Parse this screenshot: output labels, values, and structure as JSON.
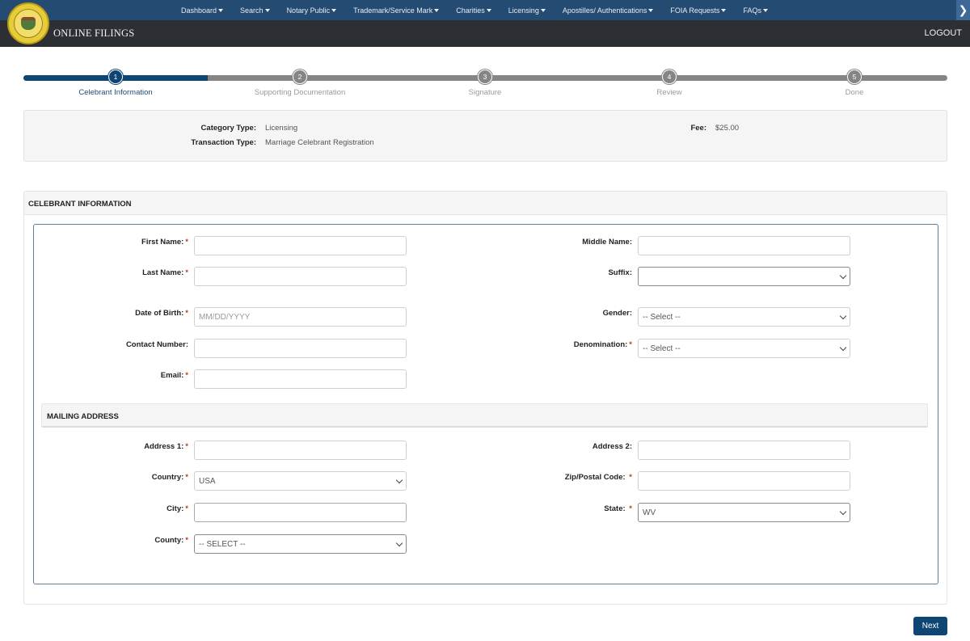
{
  "topnav": {
    "menu": [
      {
        "label": "Dashboard"
      },
      {
        "label": "Search"
      },
      {
        "label": "Notary Public"
      },
      {
        "label": "Trademark/Service Mark"
      },
      {
        "label": "Charities"
      },
      {
        "label": "Licensing"
      },
      {
        "label": "Apostilles/ Authentications"
      },
      {
        "label": "FOIA Requests"
      },
      {
        "label": "FAQs"
      }
    ],
    "expand_icon": "chevron-right"
  },
  "brand": {
    "title": "ONLINE FILINGS",
    "logout": "LOGOUT",
    "logo": "Secretary of State seal"
  },
  "stepper": {
    "current_step": 1,
    "steps": [
      {
        "number": "1",
        "label": "Celebrant Information"
      },
      {
        "number": "2",
        "label": "Supporting Documentation"
      },
      {
        "number": "3",
        "label": "Signature"
      },
      {
        "number": "4",
        "label": "Review"
      },
      {
        "number": "5",
        "label": "Done"
      }
    ]
  },
  "summary": {
    "category_type_label": "Category Type:",
    "category_type_value": "Licensing",
    "transaction_type_label": "Transaction Type:",
    "transaction_type_value": "Marriage Celebrant Registration",
    "fee_label": "Fee:",
    "fee_value": "$25.00"
  },
  "form": {
    "section_title": "CELEBRANT INFORMATION",
    "required_marker": "*",
    "fields": {
      "first_name": {
        "label": "First Name:",
        "value": "",
        "required": true
      },
      "middle_name": {
        "label": "Middle Name:",
        "value": "",
        "required": false
      },
      "last_name": {
        "label": "Last Name:",
        "value": "",
        "required": true
      },
      "suffix": {
        "label": "Suffix:",
        "value": "",
        "required": false
      },
      "date_of_birth": {
        "label": "Date of Birth:",
        "value": "",
        "placeholder": "MM/DD/YYYY",
        "required": true
      },
      "gender": {
        "label": "Gender:",
        "value": "-- Select --",
        "required": false
      },
      "contact_number": {
        "label": "Contact Number:",
        "value": "",
        "required": false
      },
      "denomination": {
        "label": "Denomination:",
        "value": "-- Select --",
        "required": true
      },
      "email": {
        "label": "Email:",
        "value": "",
        "required": true
      }
    },
    "mailing_address": {
      "title": "MAILING ADDRESS",
      "fields": {
        "address1": {
          "label": "Address 1:",
          "value": "",
          "required": true
        },
        "address2": {
          "label": "Address 2:",
          "value": "",
          "required": false
        },
        "country": {
          "label": "Country:",
          "value": "USA",
          "required": true
        },
        "zip": {
          "label": "Zip/Postal Code:",
          "value": "",
          "required": true
        },
        "city": {
          "label": "City:",
          "value": "",
          "required": true
        },
        "state": {
          "label": "State:",
          "value": "WV",
          "required": true
        },
        "county": {
          "label": "County:",
          "value": "-- SELECT --",
          "required": true
        }
      }
    }
  },
  "actions": {
    "next": "Next"
  },
  "colors": {
    "nav_bg": "#244b72",
    "brand_bg": "#2c2f33",
    "primary": "#0e4573",
    "required": "#c0392b"
  }
}
